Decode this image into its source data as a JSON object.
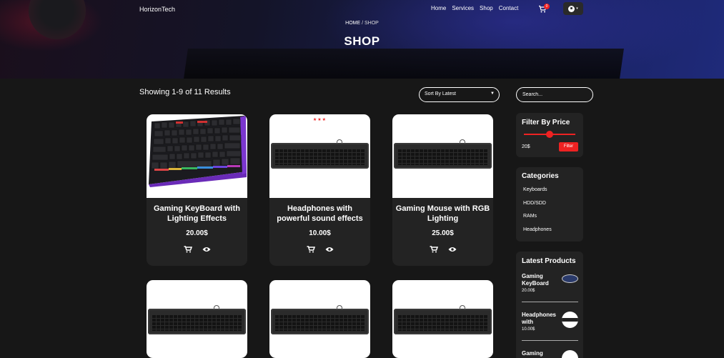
{
  "nav": {
    "brand": "HorizonTech",
    "links": [
      "Home",
      "Services",
      "Shop",
      "Contact"
    ],
    "cart_count": "0",
    "user_caret": "▾"
  },
  "hero": {
    "breadcrumb_home": "HOME",
    "breadcrumb_sep": " / ",
    "breadcrumb_current": "SHOP",
    "title": "SHOP"
  },
  "toolbar": {
    "results_text": "Showing 1-9 of 11 Results",
    "sort_label": "Sort By Latest",
    "search_placeholder": "Search..."
  },
  "products": [
    {
      "name": "Gaming KeyBoard with Lighting Effects",
      "price": "20.00$",
      "image": "rgb-keyboard",
      "stars": ""
    },
    {
      "name": "Headphones with powerful sound effects",
      "price": "10.00$",
      "image": "keyboard",
      "stars": "★★★"
    },
    {
      "name": "Gaming Mouse with RGB Lighting",
      "price": "25.00$",
      "image": "keyboard",
      "stars": ""
    },
    {
      "name": "",
      "price": "",
      "image": "keyboard",
      "stars": ""
    },
    {
      "name": "",
      "price": "",
      "image": "keyboard",
      "stars": ""
    },
    {
      "name": "",
      "price": "",
      "image": "keyboard",
      "stars": ""
    }
  ],
  "sidebar": {
    "filter": {
      "title": "Filter By Price",
      "value": "20$",
      "button": "Filter",
      "slider_fraction": 0.5
    },
    "categories": {
      "title": "Categories",
      "items": [
        "Keyboards",
        "HDD/SDD",
        "RAMs",
        "Headphones"
      ]
    },
    "latest": {
      "title": "Latest Products",
      "items": [
        {
          "name": "Gaming KeyBoard",
          "price": "20.00$"
        },
        {
          "name": "Headphones with",
          "price": "10.00$"
        },
        {
          "name": "Gaming",
          "price": ""
        }
      ]
    }
  },
  "colors": {
    "accent": "#e22222",
    "background": "#171717",
    "card": "#232323"
  }
}
